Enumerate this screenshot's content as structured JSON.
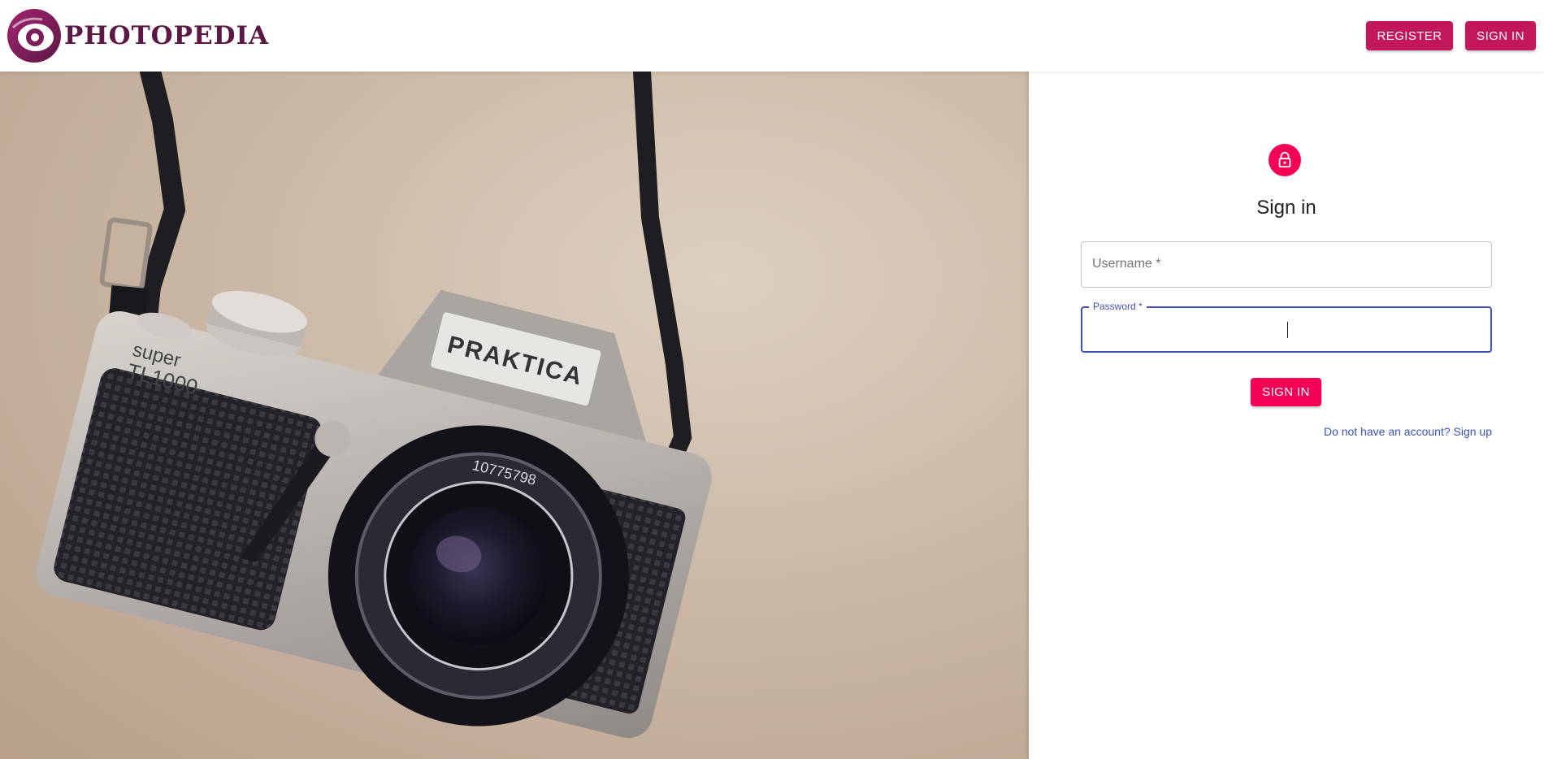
{
  "brand": {
    "name": "PHOTOPEDIA",
    "colors": {
      "logo_text": "#5b1845",
      "logo_ring_start": "#8e1b6e",
      "logo_ring_end": "#5b1845"
    }
  },
  "header": {
    "register_label": "REGISTER",
    "signin_label": "SIGN IN",
    "button_color": "#c2185b"
  },
  "hero": {
    "image": "vintage-camera-photo",
    "camera_model_text": "PRAKTICA",
    "camera_badge_line1": "super",
    "camera_badge_line2": "TL1000",
    "lens_serial": "10775798"
  },
  "signin_form": {
    "avatar_icon": "lock-icon",
    "avatar_color": "#f50057",
    "title": "Sign in",
    "username_label": "Username *",
    "username_value": "",
    "password_label": "Password *",
    "password_value": "",
    "submit_label": "SIGN IN",
    "signup_link_text": "Do not have an account? Sign up",
    "focus_color": "#3f51b5"
  }
}
